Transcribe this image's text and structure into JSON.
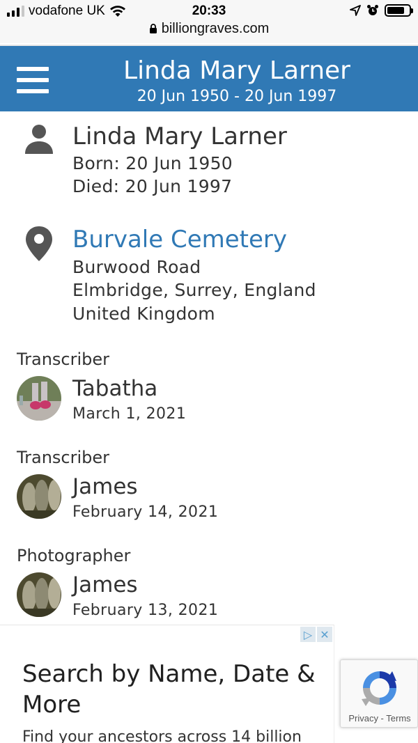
{
  "status_bar": {
    "carrier": "vodafone UK",
    "time": "20:33",
    "url": "billiongraves.com"
  },
  "header": {
    "title": "Linda Mary Larner",
    "dates": "20 Jun 1950 - 20 Jun 1997"
  },
  "person": {
    "name": "Linda Mary Larner",
    "born": "Born: 20 Jun 1950",
    "died": "Died: 20 Jun 1997"
  },
  "cemetery": {
    "name": "Burvale Cemetery",
    "address_line1": "Burwood Road",
    "address_line2": "Elmbridge, Surrey, England",
    "address_line3": "United Kingdom"
  },
  "contributors": [
    {
      "role": "Transcriber",
      "name": "Tabatha",
      "date": "March 1, 2021"
    },
    {
      "role": "Transcriber",
      "name": "James",
      "date": "February 14, 2021"
    },
    {
      "role": "Photographer",
      "name": "James",
      "date": "February 13, 2021"
    }
  ],
  "ad": {
    "headline": "Search by Name, Date & More",
    "body": "Find your ancestors across 14 billion"
  },
  "recaptcha": {
    "links": "Privacy - Terms"
  },
  "icons": {
    "person": "person-icon",
    "location": "map-pin-icon",
    "menu": "hamburger-menu-icon"
  },
  "colors": {
    "header_bg": "#3079b5",
    "link": "#3079b5"
  }
}
